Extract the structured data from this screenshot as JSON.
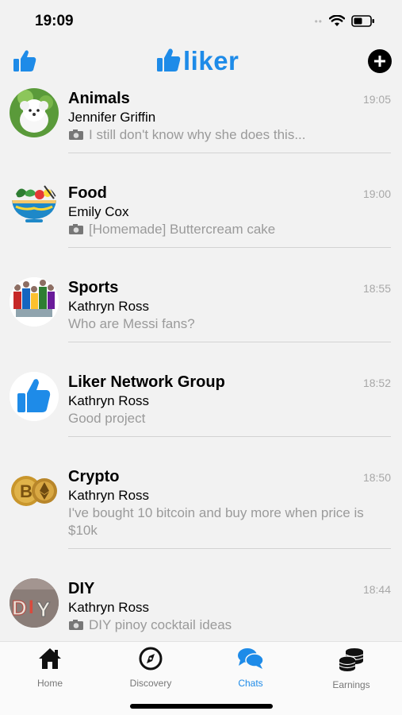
{
  "status_bar": {
    "time": "19:09"
  },
  "header": {
    "logo": "liker"
  },
  "chats": [
    {
      "title": "Animals",
      "author": "Jennifer Griffin",
      "preview": "I still don't know why she does this...",
      "time": "19:05",
      "has_photo": true,
      "avatar": "white-puppy"
    },
    {
      "title": "Food",
      "author": "Emily Cox",
      "preview": "[Homemade] Buttercream cake",
      "time": "19:00",
      "has_photo": true,
      "avatar": "salad-bowl"
    },
    {
      "title": "Sports",
      "author": "Kathryn Ross",
      "preview": "Who are Messi fans?",
      "time": "18:55",
      "has_photo": false,
      "avatar": "sports-players"
    },
    {
      "title": "Liker Network Group",
      "author": "Kathryn Ross",
      "preview": "Good project",
      "time": "18:52",
      "has_photo": false,
      "avatar": "thumbs-up"
    },
    {
      "title": "Crypto",
      "author": "Kathryn Ross",
      "preview": "I've bought 10 bitcoin and buy more when price is $10k",
      "time": "18:50",
      "has_photo": false,
      "avatar": "crypto-coins"
    },
    {
      "title": "DIY",
      "author": "Kathryn Ross",
      "preview": "DIY pinoy cocktail ideas",
      "time": "18:44",
      "has_photo": true,
      "avatar": "diy-letters"
    }
  ],
  "tabs": [
    {
      "label": "Home",
      "icon": "home-icon"
    },
    {
      "label": "Discovery",
      "icon": "compass-icon"
    },
    {
      "label": "Chats",
      "icon": "chat-bubbles-icon",
      "active": true
    },
    {
      "label": "Earnings",
      "icon": "coins-icon"
    }
  ],
  "colors": {
    "accent": "#1e8be8",
    "background": "#f2f2f2",
    "muted_text": "#9a9a9a"
  }
}
